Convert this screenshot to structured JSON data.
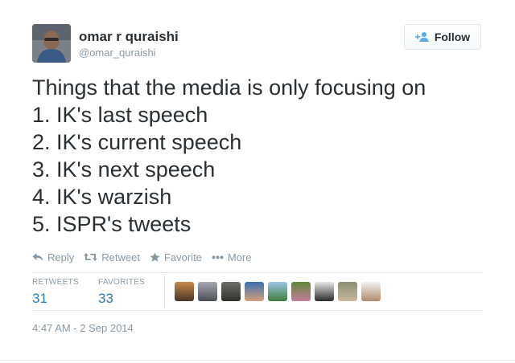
{
  "author": {
    "name": "omar r quraishi",
    "handle": "@omar_quraishi"
  },
  "follow_button": {
    "label": "Follow"
  },
  "tweet": {
    "lines": [
      "Things that the media is only focusing on",
      "1. IK's last speech",
      "2. IK's current speech",
      "3. IK's next speech",
      "4. IK's warzish",
      "5. ISPR's tweets"
    ]
  },
  "actions": {
    "reply": "Reply",
    "retweet": "Retweet",
    "favorite": "Favorite",
    "more": "More"
  },
  "stats": {
    "retweets_label": "RETWEETS",
    "retweets_count": "31",
    "favorites_label": "FAVORITES",
    "favorites_count": "33"
  },
  "favoriter_avatar_count": 9,
  "timestamp": "4:47 AM - 2 Sep 2014",
  "colors": {
    "link_blue": "#2b7bb9",
    "muted_gray": "#8899a6",
    "text": "#292f33",
    "border": "#e1e8ed"
  },
  "icons": [
    "user-avatar",
    "follow-person-plus-icon",
    "reply-icon",
    "retweet-icon",
    "star-icon",
    "more-dots-icon"
  ]
}
